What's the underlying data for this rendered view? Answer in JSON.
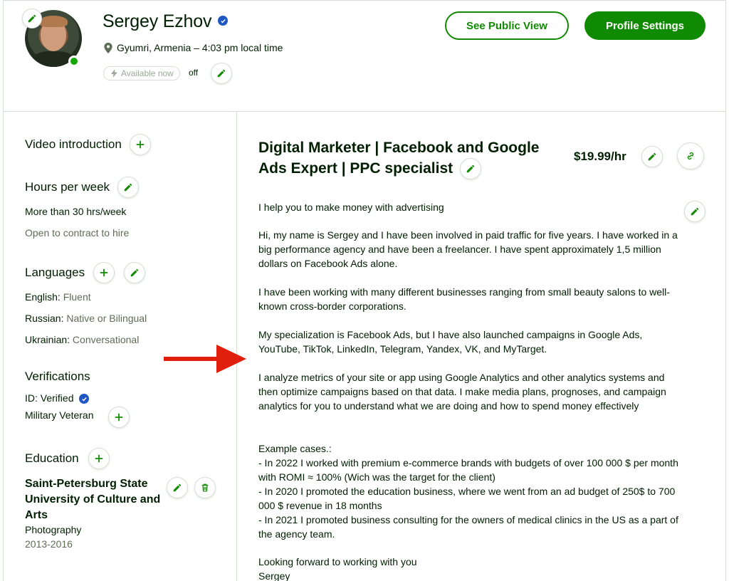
{
  "profile": {
    "name": "Sergey Ezhov",
    "location": "Gyumri, Armenia – 4:03 pm local time",
    "availability": "Available now",
    "availability_state": "off"
  },
  "header_buttons": {
    "public_view": "See Public View",
    "settings": "Profile Settings"
  },
  "sidebar": {
    "video_intro": "Video introduction",
    "hours_title": "Hours per week",
    "hours_value": "More than 30 hrs/week",
    "hours_note": "Open to contract to hire",
    "languages_title": "Languages",
    "languages": [
      {
        "name": "English:",
        "level": "Fluent"
      },
      {
        "name": "Russian:",
        "level": "Native or Bilingual"
      },
      {
        "name": "Ukrainian:",
        "level": "Conversational"
      }
    ],
    "verifications_title": "Verifications",
    "id_label": "ID: Verified",
    "military": "Military Veteran",
    "education_title": "Education",
    "education": {
      "school": "Saint-Petersburg State University of Culture and Arts",
      "field": "Photography",
      "years": "2013-2016"
    }
  },
  "main": {
    "title": "Digital Marketer | Facebook and Google Ads Expert | PPC specialist",
    "rate": "$19.99/hr",
    "overview": [
      "I help you to make money with advertising",
      "Hi, my name is Sergey and I have been involved in paid traffic for five years. I have worked in a big performance agency and have been a freelancer. I have spent approximately 1,5 million dollars on Facebook Ads alone.",
      "I have been working with many different businesses ranging from small beauty salons to well-known cross-border corporations.",
      "My specialization is Facebook Ads, but I have also launched campaigns in Google Ads, YouTube, TikTok, LinkedIn, Telegram, Yandex, VK, and MyTarget.",
      "I analyze metrics of your site or app using Google Analytics and other analytics systems and then optimize campaigns based on that data. I make media plans, prognoses, and campaign analytics for you to understand what we are doing and how to spend money effectively",
      "Example cases.:",
      "- In 2022 I worked with premium e-commerce brands with budgets of over 100 000 $ per month with ROMI ≈ 100% (Wich was the target for the client)",
      "- In 2020 I promoted the education business, where we went from an ad budget of 250$ to 700 000 $ revenue in 18 months",
      "- In 2021 I promoted business consulting for the owners of medical clinics in the US as a part of the agency team.",
      "Looking forward to working with you",
      "Sergey"
    ]
  },
  "colors": {
    "brand_green": "#108a00",
    "online_green": "#14a800",
    "verified_blue": "#1f57c3",
    "annotation_arrow": "#e0200d"
  },
  "icons": [
    "pencil-icon",
    "plus-icon",
    "trash-icon",
    "link-icon",
    "location-pin-icon",
    "lightning-icon",
    "verified-check-icon",
    "arrow-annotation"
  ]
}
